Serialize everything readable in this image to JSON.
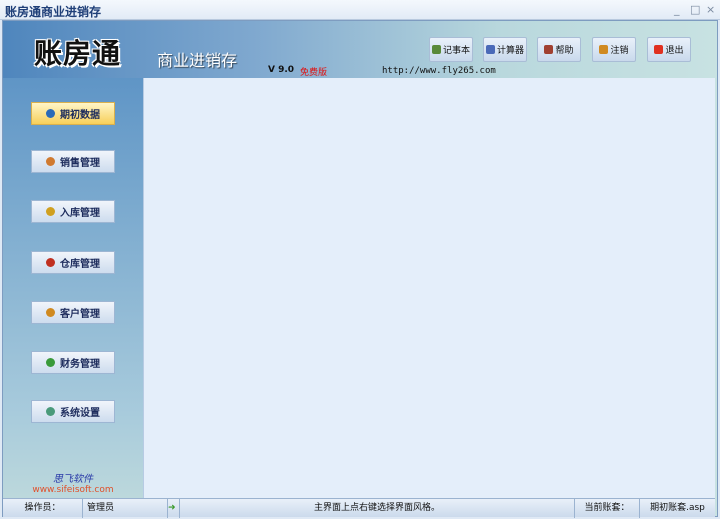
{
  "window": {
    "title": "账房通商业进销存",
    "minimize": "_",
    "maximize": "□",
    "close": "×"
  },
  "header": {
    "logo": "账房通",
    "subtitle": "商业进销存",
    "version": "V 9.0",
    "edition": "免费版",
    "url": "http://www.fly265.com"
  },
  "toolbar": [
    {
      "label": "记事本",
      "icon": "notepad-icon",
      "color": "#5a8a3a"
    },
    {
      "label": "计算器",
      "icon": "calculator-icon",
      "color": "#4a6ab8"
    },
    {
      "label": "帮助",
      "icon": "help-icon",
      "color": "#a04030"
    },
    {
      "label": "注销",
      "icon": "logout-user-icon",
      "color": "#d08a20"
    },
    {
      "label": "退出",
      "icon": "exit-icon",
      "color": "#e03020"
    }
  ],
  "sidebar": [
    {
      "label": "期初数据",
      "icon": "book-icon",
      "color": "#2a6ab8",
      "active": true
    },
    {
      "label": "销售管理",
      "icon": "sales-icon",
      "color": "#d07a30"
    },
    {
      "label": "入库管理",
      "icon": "box-icon",
      "color": "#d0a020"
    },
    {
      "label": "仓库管理",
      "icon": "warehouse-icon",
      "color": "#c03020"
    },
    {
      "label": "客户管理",
      "icon": "customers-icon",
      "color": "#d08a20"
    },
    {
      "label": "财务管理",
      "icon": "finance-icon",
      "color": "#3a9a3a"
    },
    {
      "label": "系统设置",
      "icon": "settings-icon",
      "color": "#4a9a7a"
    }
  ],
  "brand": {
    "name": "思飞软件",
    "url": "www.sifeisoft.com"
  },
  "status": {
    "operator_label": "操作员：",
    "operator": "管理员",
    "message": "主界面上点右键选择界面风格。",
    "account_label": "当前账套：",
    "account": "期初账套.asp"
  }
}
